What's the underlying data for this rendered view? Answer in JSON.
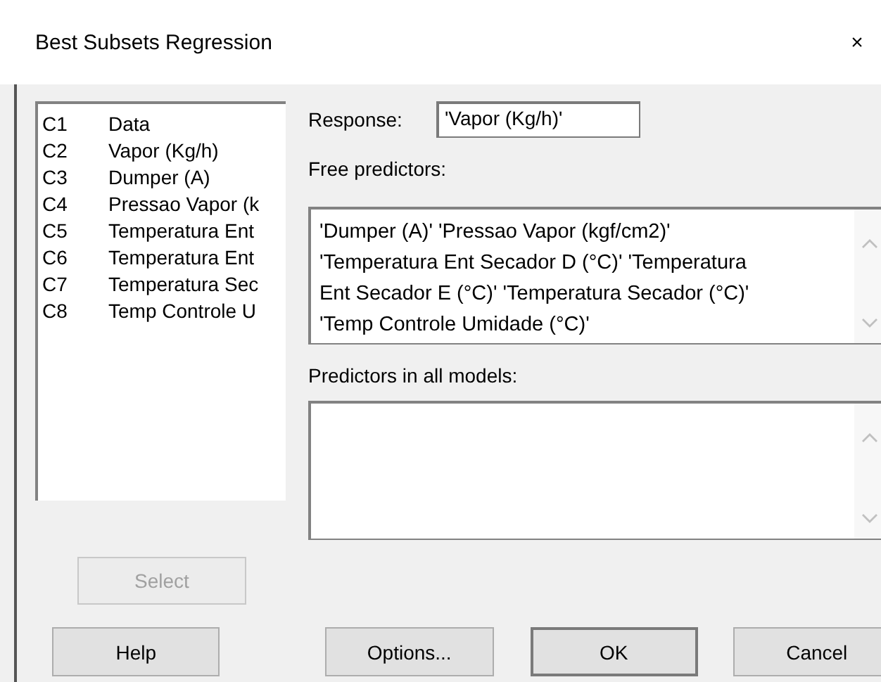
{
  "window": {
    "title": "Best Subsets Regression",
    "close": "×"
  },
  "columns": [
    {
      "id": "C1",
      "name": "Data"
    },
    {
      "id": "C2",
      "name": "Vapor (Kg/h)"
    },
    {
      "id": "C3",
      "name": "Dumper (A)"
    },
    {
      "id": "C4",
      "name": "Pressao Vapor (k"
    },
    {
      "id": "C5",
      "name": "Temperatura Ent"
    },
    {
      "id": "C6",
      "name": "Temperatura Ent"
    },
    {
      "id": "C7",
      "name": "Temperatura Sec"
    },
    {
      "id": "C8",
      "name": "Temp Controle U"
    }
  ],
  "select_button": {
    "label": "Select",
    "disabled": true
  },
  "response": {
    "label": "Response:",
    "value": "'Vapor (Kg/h)'"
  },
  "free_predictors": {
    "label": "Free predictors:",
    "lines": [
      "'Dumper (A)' 'Pressao Vapor (kgf/cm2)'",
      "'Temperatura Ent Secador D (°C)' 'Temperatura",
      "Ent Secador E (°C)' 'Temperatura Secador (°C)'",
      "'Temp Controle Umidade (°C)'"
    ]
  },
  "predictors_all_models": {
    "label": "Predictors in all models:"
  },
  "buttons": [
    {
      "label": "Help"
    },
    {
      "label": "Options..."
    },
    {
      "label": "OK"
    },
    {
      "label": "Cancel"
    }
  ]
}
